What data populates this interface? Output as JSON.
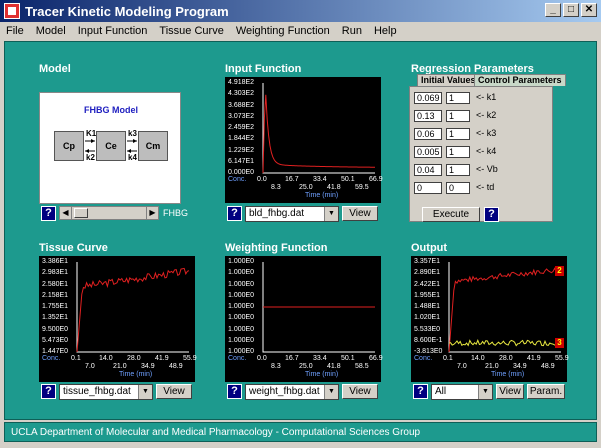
{
  "window": {
    "title": "Tracer Kinetic Modeling Program"
  },
  "menu": [
    "File",
    "Model",
    "Input Function",
    "Tissue Curve",
    "Weighting Function",
    "Run",
    "Help"
  ],
  "model_panel": {
    "title": "Model",
    "diagram_title": "FHBG Model",
    "compartments": [
      "Cp",
      "Ce",
      "Cm"
    ],
    "rates": [
      "K1",
      "k2",
      "k3",
      "k4"
    ],
    "label": "FHBG"
  },
  "input_panel": {
    "title": "Input Function",
    "y_ticks": [
      "4.918E2",
      "4.303E2",
      "3.688E2",
      "3.073E2",
      "2.459E2",
      "1.844E2",
      "1.229E2",
      "6.147E1",
      "0.000E0"
    ],
    "x_ticks_top": [
      "0.0",
      "16.7",
      "33.4",
      "50.1",
      "66.9"
    ],
    "x_ticks_bottom": [
      "8.3",
      "25.0",
      "41.8",
      "59.5"
    ],
    "conc": "Conc.",
    "time": "Time (min)",
    "file": "bld_fhbg.dat",
    "view": "View"
  },
  "regression": {
    "title": "Regression Parameters",
    "tabs": [
      "Initial Values",
      "Control Parameters"
    ],
    "params": [
      {
        "value": "0.069",
        "flag": "1",
        "label": "<- k1"
      },
      {
        "value": "0.13",
        "flag": "1",
        "label": "<- k2"
      },
      {
        "value": "0.06",
        "flag": "1",
        "label": "<- k3"
      },
      {
        "value": "0.005",
        "flag": "1",
        "label": "<- k4"
      },
      {
        "value": "0.04",
        "flag": "1",
        "label": "<- Vb"
      },
      {
        "value": "0",
        "flag": "0",
        "label": "<- td"
      }
    ],
    "execute": "Execute"
  },
  "tissue_panel": {
    "title": "Tissue Curve",
    "y_ticks": [
      "3.386E1",
      "2.983E1",
      "2.580E1",
      "2.158E1",
      "1.755E1",
      "1.352E1",
      "9.500E0",
      "5.473E0",
      "1.447E0"
    ],
    "x_ticks_top": [
      "0.1",
      "14.0",
      "28.0",
      "41.9",
      "55.9"
    ],
    "x_ticks_bottom": [
      "7.0",
      "21.0",
      "34.9",
      "48.9"
    ],
    "conc": "Conc.",
    "time": "Time (min)",
    "file": "tissue_fhbg.dat",
    "view": "View"
  },
  "weighting_panel": {
    "title": "Weighting Function",
    "y_ticks": [
      "1.000E0",
      "1.000E0",
      "1.000E0",
      "1.000E0",
      "1.000E0",
      "1.000E0",
      "1.000E0",
      "1.000E0",
      "1.000E0"
    ],
    "x_ticks_top": [
      "0.0",
      "16.7",
      "33.4",
      "50.1",
      "66.9"
    ],
    "x_ticks_bottom": [
      "8.3",
      "25.0",
      "41.8",
      "58.5"
    ],
    "conc": "Conc.",
    "time": "Time (min)",
    "file": "weight_fhbg.dat",
    "view": "View"
  },
  "output_panel": {
    "title": "Output",
    "y_ticks": [
      "3.357E1",
      "2.890E1",
      "2.422E1",
      "1.955E1",
      "1.488E1",
      "1.020E1",
      "5.533E0",
      "8.600E-1",
      "-3.813E0"
    ],
    "x_ticks_top": [
      "0.1",
      "14.0",
      "28.0",
      "41.9",
      "55.9"
    ],
    "x_ticks_bottom": [
      "7.0",
      "21.0",
      "34.9",
      "48.9"
    ],
    "conc": "Conc.",
    "time": "Time (min)",
    "select": "All",
    "view": "View",
    "param": "Param.",
    "markers": [
      "2",
      "3"
    ]
  },
  "help": "?",
  "status": "UCLA Department of Molecular and Medical Pharmacology - Computational Sciences Group",
  "colors": {
    "background": "#1d9a8e",
    "curve_red": "#e02020",
    "curve_yellow": "#e8e840",
    "axis_blue": "#6fa0ff"
  }
}
